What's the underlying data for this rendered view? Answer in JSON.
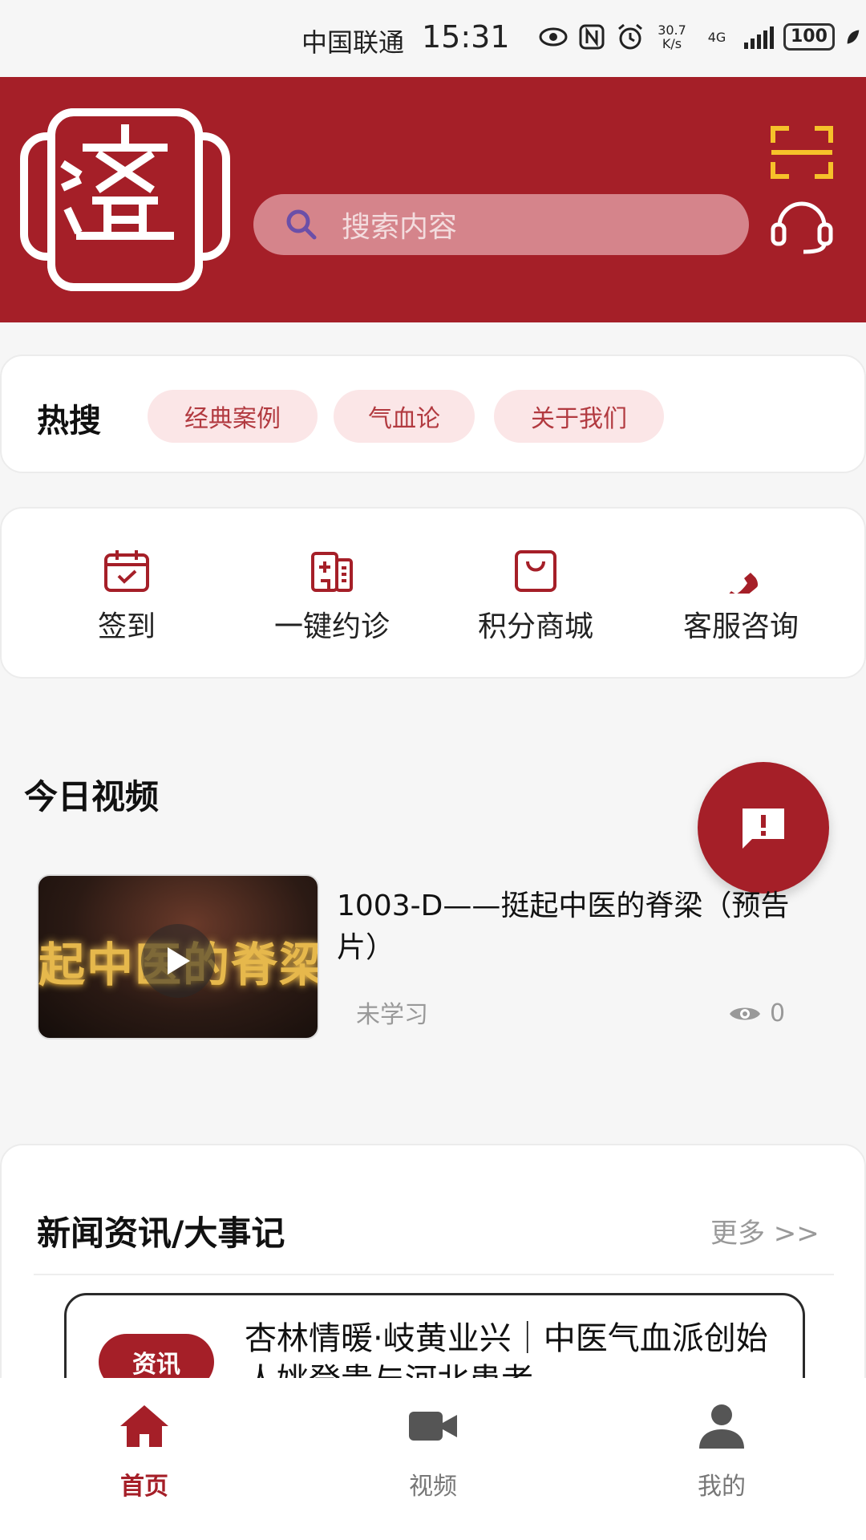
{
  "status_bar": {
    "carrier": "中国联通",
    "time": "15:31",
    "net_speed_value": "30.7",
    "net_speed_unit": "K/s",
    "network_type": "4G",
    "battery": "100",
    "icons": [
      "eye-icon",
      "nfc-icon",
      "alarm-icon",
      "signal-icon",
      "battery-icon",
      "leaf-icon"
    ]
  },
  "header": {
    "logo_icon": "jishi-seal-logo",
    "search_placeholder": "搜索内容",
    "scan_icon": "scan-icon",
    "service_icon": "headset-icon",
    "brand_color": "#a51f28"
  },
  "hot_search": {
    "title": "热搜",
    "tags": [
      "经典案例",
      "气血论",
      "关于我们"
    ]
  },
  "quick_actions": [
    {
      "label": "签到",
      "icon": "calendar-check-icon"
    },
    {
      "label": "一键约诊",
      "icon": "hospital-icon"
    },
    {
      "label": "积分商城",
      "icon": "shopping-bag-icon"
    },
    {
      "label": "客服咨询",
      "icon": "phone-icon"
    }
  ],
  "today_video": {
    "title": "今日视频",
    "video": {
      "title": "1003-D——挺起中医的脊梁（预告片）",
      "thumbnail_text": "起中医的脊梁",
      "status": "未学习",
      "views": "0"
    },
    "feedback_icon": "message-alert-icon"
  },
  "news": {
    "title": "新闻资讯/大事记",
    "more": "更多 >>",
    "items": [
      {
        "badge": "资讯",
        "text": "杏林情暖·岐黄业兴｜中医气血派创始人姚登贵与河北患者…"
      }
    ]
  },
  "bottom_nav": {
    "items": [
      {
        "label": "首页",
        "icon": "home-icon",
        "active": true
      },
      {
        "label": "视频",
        "icon": "video-camera-icon",
        "active": false
      },
      {
        "label": "我的",
        "icon": "user-icon",
        "active": false
      }
    ],
    "active_color": "#a51f28"
  }
}
